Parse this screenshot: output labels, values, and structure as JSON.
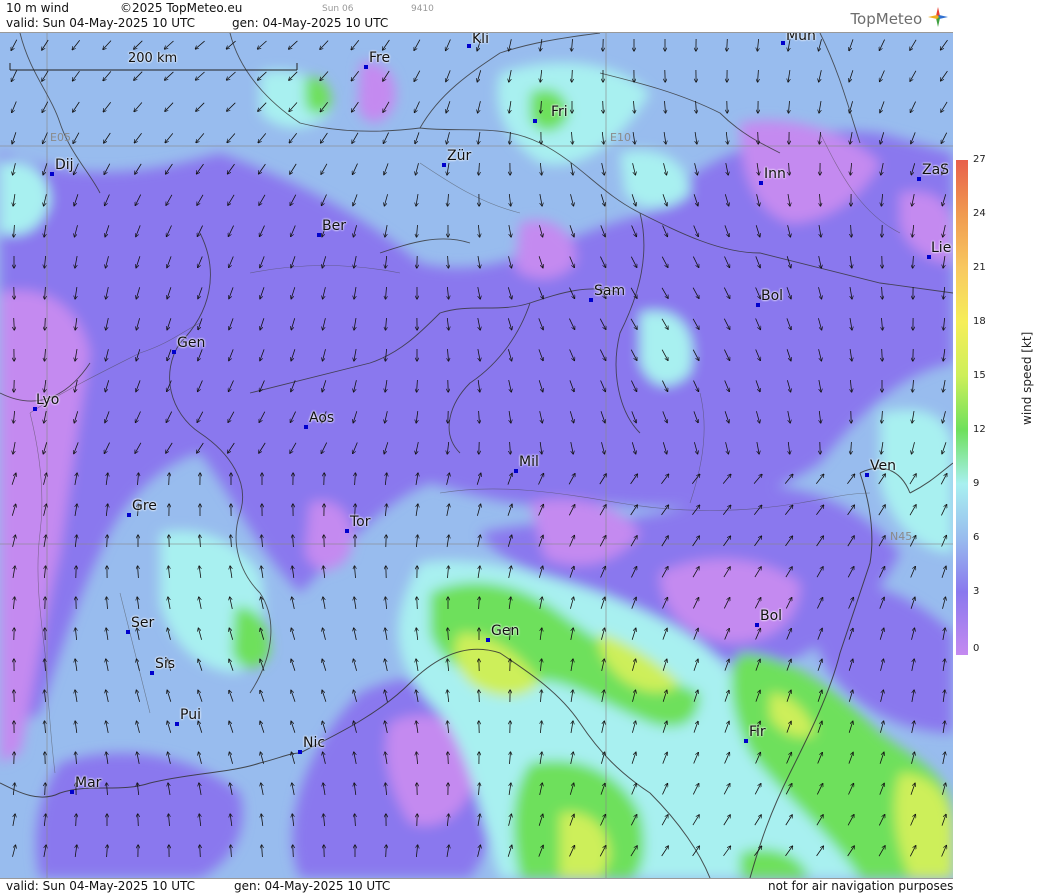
{
  "header": {
    "product": "10 m wind",
    "copyright": "©2025 TopMeteo.eu",
    "valid": "valid:  Sun  04-May-2025  10 UTC",
    "gen": "gen: 04-May-2025 10 UTC",
    "day_small": "Sun 06",
    "code_small": "9410",
    "logo": "TopMeteo"
  },
  "footer": {
    "valid": "valid:  Sun  04-May-2025  10 UTC",
    "gen": "gen: 04-May-2025 10 UTC",
    "disclaimer": "not for air navigation purposes"
  },
  "map": {
    "scale_label": "200 km",
    "grid_labels": [
      {
        "text": "E05"
      },
      {
        "text": "E10"
      },
      {
        "text": "N45"
      }
    ],
    "cities": [
      {
        "name": "Kli"
      },
      {
        "name": "Mun"
      },
      {
        "name": "Fre"
      },
      {
        "name": "Fri"
      },
      {
        "name": "Dij"
      },
      {
        "name": "Zür"
      },
      {
        "name": "Inn"
      },
      {
        "name": "ZaS"
      },
      {
        "name": "Ber"
      },
      {
        "name": "Lie"
      },
      {
        "name": "Sam"
      },
      {
        "name": "Bol"
      },
      {
        "name": "Gen"
      },
      {
        "name": "Lyo"
      },
      {
        "name": "Aos"
      },
      {
        "name": "Mil"
      },
      {
        "name": "Ven"
      },
      {
        "name": "Gre"
      },
      {
        "name": "Tor"
      },
      {
        "name": "Ser"
      },
      {
        "name": "Gen"
      },
      {
        "name": "Bol"
      },
      {
        "name": "Sis"
      },
      {
        "name": "Pui"
      },
      {
        "name": "Fir"
      },
      {
        "name": "Nic"
      },
      {
        "name": "Mar"
      }
    ]
  },
  "legend": {
    "title": "wind speed [kt]",
    "ticks": [
      "27",
      "24",
      "21",
      "18",
      "15",
      "12",
      "9",
      "6",
      "3",
      "0"
    ],
    "colors": [
      "#e8604c",
      "#f09a50",
      "#f8c860",
      "#f6ee58",
      "#cdef5a",
      "#6ee05c",
      "#a8f0f0",
      "#98bcee",
      "#8a78ee",
      "#c48af0"
    ]
  },
  "colors": {
    "purple_light": "#c48af0",
    "purple": "#8a78ee",
    "blue": "#98bcee",
    "cyan": "#a8f0f0",
    "green": "#6ee05c",
    "yellowgreen": "#cdef5a"
  }
}
